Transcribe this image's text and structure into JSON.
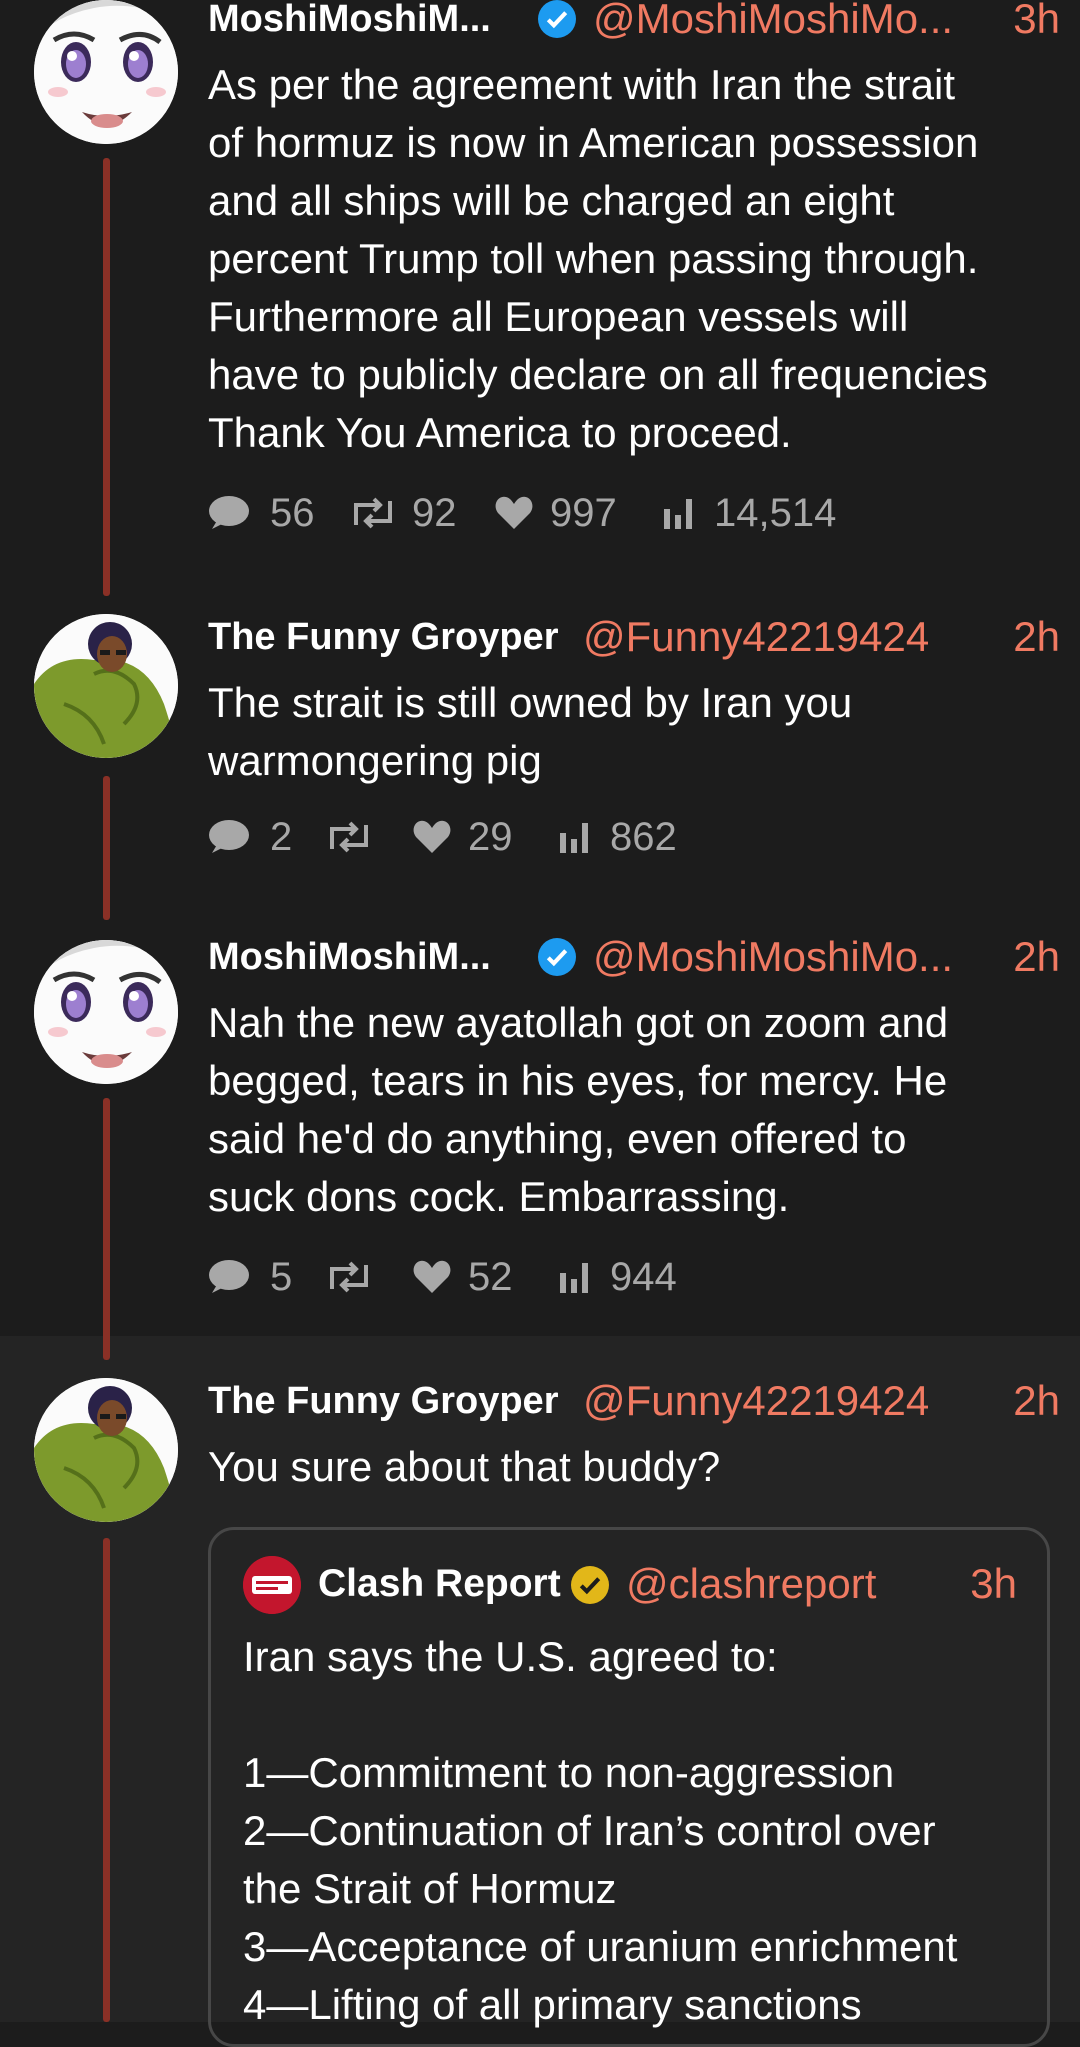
{
  "posts": [
    {
      "name": "MoshiMoshiM...",
      "verified": true,
      "handle": "@MoshiMoshiMo...",
      "time": "3h",
      "text": "As per the agreement with Iran the strait\nof hormuz is now in American possession\nand all ships will be charged an eight\npercent Trump toll when passing through.\nFurthermore all European vessels will\nhave to publicly declare on all frequencies\nThank You America to proceed.",
      "replies": "56",
      "reposts": "92",
      "likes": "997",
      "views": "14,514"
    },
    {
      "name": "The Funny Groyper",
      "verified": false,
      "handle": "@Funny42219424",
      "time": "2h",
      "text": "The strait is still owned by Iran you\nwarmongering pig",
      "replies": "2",
      "reposts": "",
      "likes": "29",
      "views": "862"
    },
    {
      "name": "MoshiMoshiM...",
      "verified": true,
      "handle": "@MoshiMoshiMo...",
      "time": "2h",
      "text": "Nah the new ayatollah got on zoom and\nbegged, tears in his eyes, for mercy.  He\nsaid he'd do anything, even offered to\nsuck dons cock.  Embarrassing.",
      "replies": "5",
      "reposts": "",
      "likes": "52",
      "views": "944"
    },
    {
      "name": "The Funny Groyper",
      "verified": false,
      "handle": "@Funny42219424",
      "time": "2h",
      "text": "You sure about that buddy?"
    }
  ],
  "quote": {
    "name": "Clash Report",
    "handle": "@clashreport",
    "time": "3h",
    "text": "Iran says the U.S. agreed to:\n\n1—Commitment to non-aggression\n2—Continuation of Iran’s control over\nthe Strait of Hormuz\n3—Acceptance of uranium enrichment\n4—Lifting of all primary sanctions"
  },
  "colors": {
    "background": "#1c1c1c",
    "accent": "#f07a62",
    "thread_line": "#8a3026",
    "verified_blue": "#1d9bf0",
    "verified_gold": "#e2b719",
    "muted": "#a8a8a8"
  }
}
